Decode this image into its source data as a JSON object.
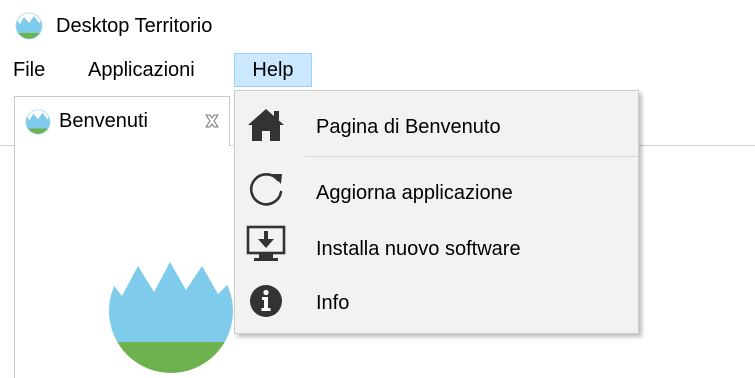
{
  "window": {
    "title": "Desktop Territorio",
    "logo_icon": "mountain-logo-icon"
  },
  "menubar": {
    "items": [
      {
        "label": "File"
      },
      {
        "label": "Applicazioni"
      },
      {
        "label": "Help",
        "active": true
      }
    ]
  },
  "tabs": [
    {
      "label": "Benvenuti",
      "close_icon": "close-tab-icon"
    }
  ],
  "help_menu": {
    "items": [
      {
        "label": "Pagina di Benvenuto",
        "icon": "home-icon"
      },
      {
        "label": "Aggiorna  applicazione",
        "icon": "refresh-icon"
      },
      {
        "label": "Installa nuovo software",
        "icon": "install-software-icon"
      },
      {
        "label": "Info",
        "icon": "info-icon"
      }
    ]
  },
  "colors": {
    "menu_highlight": "#cce8ff",
    "menu_highlight_border": "#99d1ff",
    "dropdown_bg": "#f2f2f2",
    "logo_sky": "#7fcbec",
    "logo_grass": "#6db24f",
    "icon_dark": "#333333"
  }
}
